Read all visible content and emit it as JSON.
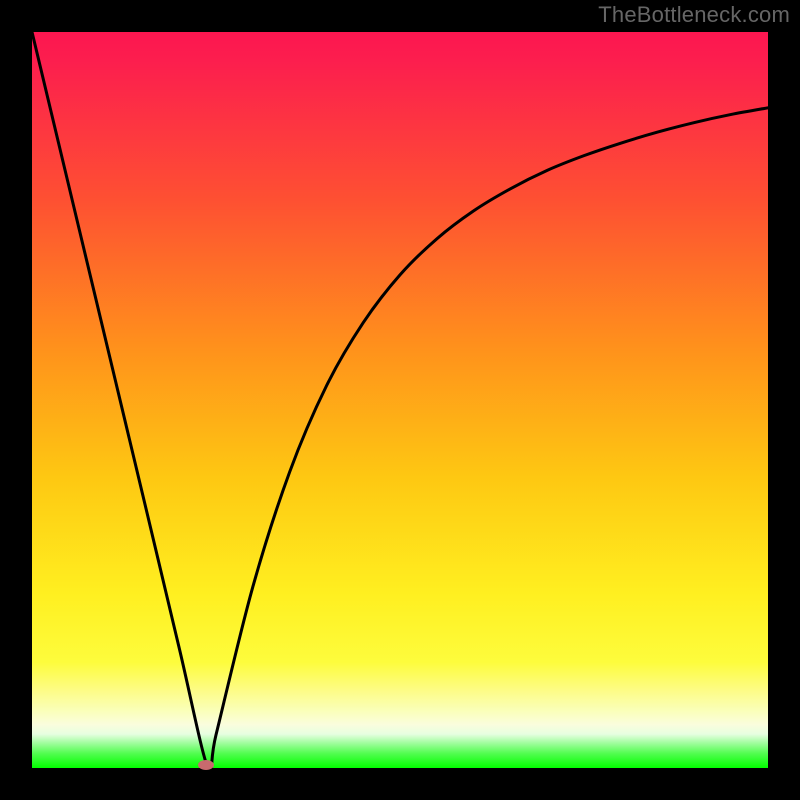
{
  "watermark": "TheBottleneck.com",
  "chart_data": {
    "type": "line",
    "title": "",
    "xlabel": "",
    "ylabel": "",
    "xlim": [
      0,
      100
    ],
    "ylim": [
      0,
      100
    ],
    "grid": false,
    "legend": false,
    "series": [
      {
        "name": "bottleneck-curve",
        "x": [
          0,
          5,
          10,
          15,
          20,
          23.9,
          25,
          30,
          35,
          40,
          45,
          50,
          55,
          60,
          65,
          70,
          75,
          80,
          85,
          90,
          95,
          100
        ],
        "y": [
          100,
          79.1,
          58.2,
          37.3,
          16.3,
          0,
          4.5,
          24.6,
          40.2,
          51.9,
          60.5,
          67.0,
          71.9,
          75.7,
          78.7,
          81.2,
          83.2,
          84.9,
          86.4,
          87.7,
          88.8,
          89.7
        ]
      }
    ],
    "marker": {
      "x": 23.7,
      "y": 0.4,
      "name": "optimal-point"
    },
    "background_gradient": {
      "stops": [
        {
          "pct": 0.0,
          "color": "#fc1650"
        },
        {
          "pct": 3.9,
          "color": "#fc1e4e"
        },
        {
          "pct": 22.8,
          "color": "#fe5032"
        },
        {
          "pct": 43.5,
          "color": "#ff931b"
        },
        {
          "pct": 60.6,
          "color": "#fec812"
        },
        {
          "pct": 76.2,
          "color": "#ffef20"
        },
        {
          "pct": 85.6,
          "color": "#fdfc3c"
        },
        {
          "pct": 89.5,
          "color": "#fdfc87"
        },
        {
          "pct": 92.1,
          "color": "#faffb7"
        },
        {
          "pct": 94.1,
          "color": "#fafddd"
        },
        {
          "pct": 95.4,
          "color": "#e6fee0"
        },
        {
          "pct": 96.7,
          "color": "#9bfd99"
        },
        {
          "pct": 98.0,
          "color": "#53fd51"
        },
        {
          "pct": 100.0,
          "color": "#03fe00"
        }
      ]
    }
  }
}
